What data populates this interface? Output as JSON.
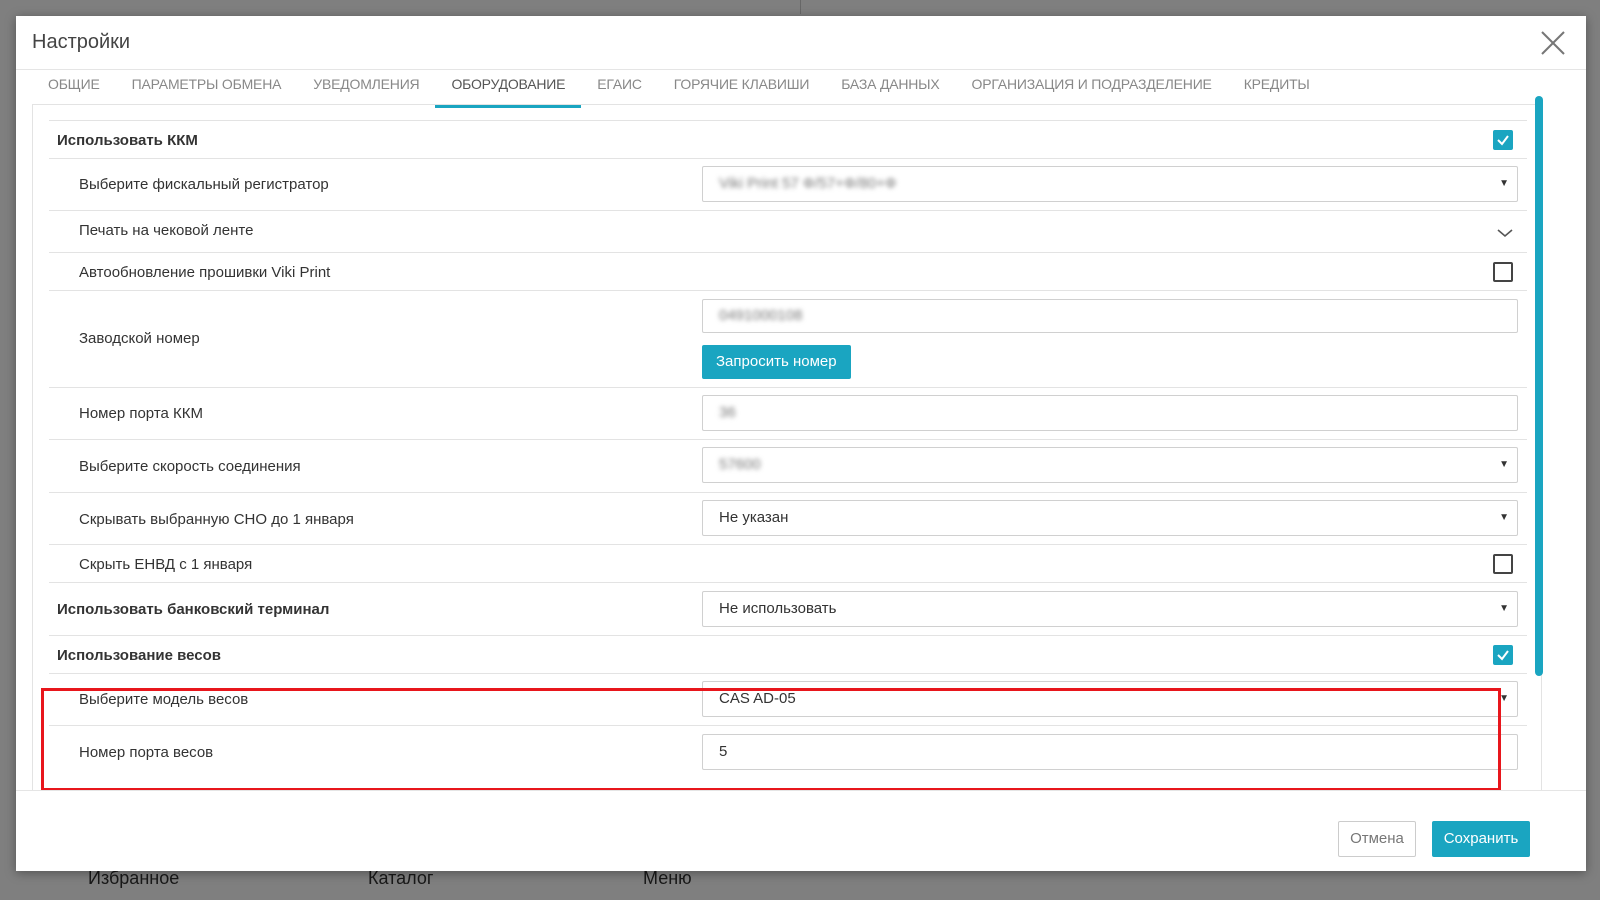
{
  "background": {
    "nav": [
      "Избранное",
      "Каталог",
      "Меню"
    ]
  },
  "modal": {
    "title": "Настройки",
    "close_icon": "close-icon"
  },
  "tabs": [
    {
      "label": "Общие"
    },
    {
      "label": "Параметры обмена"
    },
    {
      "label": "Уведомления"
    },
    {
      "label": "Оборудование",
      "active": true
    },
    {
      "label": "ЕГАИС"
    },
    {
      "label": "Горячие клавиши"
    },
    {
      "label": "База данных"
    },
    {
      "label": "Организация и подразделение"
    },
    {
      "label": "Кредиты"
    }
  ],
  "settings": {
    "use_kkm": {
      "label": "Использовать ККМ",
      "checked": true
    },
    "fiscal_registrar": {
      "label": "Выберите фискальный регистратор",
      "value": "Viki Print 57 Ф/57+Ф/80+Ф"
    },
    "receipt_print": {
      "label": "Печать на чековой ленте"
    },
    "viki_autoupdate": {
      "label": "Автообновление прошивки Viki Print",
      "checked": false
    },
    "serial_number": {
      "label": "Заводской номер",
      "value": "0491000108",
      "button": "Запросить номер"
    },
    "kkm_port": {
      "label": "Номер порта ККМ",
      "value": "36"
    },
    "baud_rate": {
      "label": "Выберите скорость соединения",
      "value": "57600"
    },
    "hide_sno": {
      "label": "Скрывать выбранную СНО до 1 января",
      "value": "Не указан"
    },
    "hide_envd": {
      "label": "Скрыть ЕНВД с 1 января",
      "checked": false
    },
    "bank_terminal": {
      "label": "Использовать банковский терминал",
      "value": "Не использовать"
    },
    "use_scales": {
      "label": "Использование весов",
      "checked": true
    },
    "scale_model": {
      "label": "Выберите модель весов",
      "value": "CAS AD-05"
    },
    "scale_port": {
      "label": "Номер порта весов",
      "value": "5"
    }
  },
  "footer": {
    "cancel_label": "Отмена",
    "save_label": "Сохранить"
  },
  "colors": {
    "accent": "#1aa5c1",
    "highlight": "#e8161c"
  }
}
